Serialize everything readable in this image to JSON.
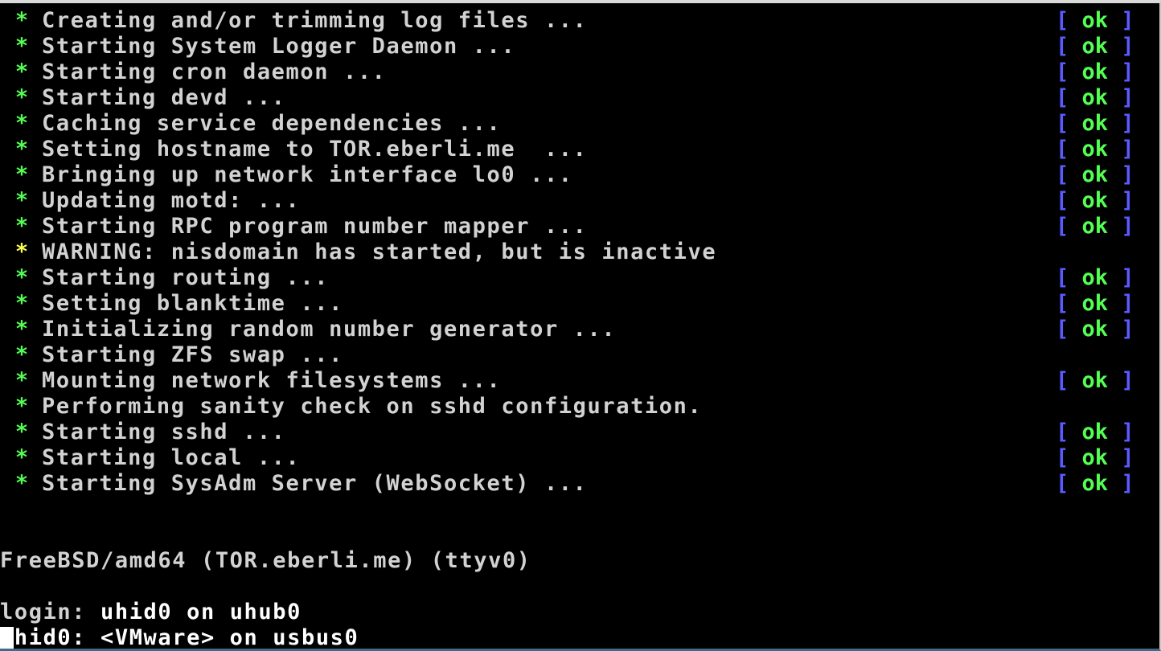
{
  "boot_lines": [
    {
      "bullet": "*",
      "bullet_color": "#54ff54",
      "text": "Creating and/or trimming log files ...",
      "ok": true
    },
    {
      "bullet": "*",
      "bullet_color": "#54ff54",
      "text": "Starting System Logger Daemon ...",
      "ok": true
    },
    {
      "bullet": "*",
      "bullet_color": "#54ff54",
      "text": "Starting cron daemon ...",
      "ok": true
    },
    {
      "bullet": "*",
      "bullet_color": "#54ff54",
      "text": "Starting devd ...",
      "ok": true
    },
    {
      "bullet": "*",
      "bullet_color": "#54ff54",
      "text": "Caching service dependencies ...",
      "ok": true
    },
    {
      "bullet": "*",
      "bullet_color": "#54ff54",
      "text": "Setting hostname to TOR.eberli.me  ...",
      "ok": true
    },
    {
      "bullet": "*",
      "bullet_color": "#54ff54",
      "text": "Bringing up network interface lo0 ...",
      "ok": true
    },
    {
      "bullet": "*",
      "bullet_color": "#54ff54",
      "text": "Updating motd: ...",
      "ok": true
    },
    {
      "bullet": "*",
      "bullet_color": "#54ff54",
      "text": "Starting RPC program number mapper ...",
      "ok": true
    },
    {
      "bullet": "*",
      "bullet_color": "#ffff54",
      "text": "WARNING: nisdomain has started, but is inactive",
      "ok": false
    },
    {
      "bullet": "*",
      "bullet_color": "#54ff54",
      "text": "Starting routing ...",
      "ok": true
    },
    {
      "bullet": "*",
      "bullet_color": "#54ff54",
      "text": "Setting blanktime ...",
      "ok": true
    },
    {
      "bullet": "*",
      "bullet_color": "#54ff54",
      "text": "Initializing random number generator ...",
      "ok": true
    },
    {
      "bullet": "*",
      "bullet_color": "#54ff54",
      "text": "Starting ZFS swap ...",
      "ok": false
    },
    {
      "bullet": "*",
      "bullet_color": "#54ff54",
      "text": "Mounting network filesystems ...",
      "ok": true
    },
    {
      "bullet": "*",
      "bullet_color": "#54ff54",
      "text": "Performing sanity check on sshd configuration.",
      "ok": false
    },
    {
      "bullet": "*",
      "bullet_color": "#54ff54",
      "text": "Starting sshd ...",
      "ok": true
    },
    {
      "bullet": "*",
      "bullet_color": "#54ff54",
      "text": "Starting local ...",
      "ok": true
    },
    {
      "bullet": "*",
      "bullet_color": "#54ff54",
      "text": "Starting SysAdm Server (WebSocket) ...",
      "ok": true
    }
  ],
  "status": {
    "open_bracket": "[",
    "ok_label": "ok",
    "close_bracket": "]",
    "bracket_color": "#5a5aff",
    "ok_color": "#54ff54"
  },
  "console": {
    "banner": "FreeBSD/amd64 (TOR.eberli.me) (ttyv0)",
    "login_prompt": "login:",
    "login_tail": " uhid0 on uhub0",
    "device_line": "uhid0: <VMware> on usbus0"
  }
}
